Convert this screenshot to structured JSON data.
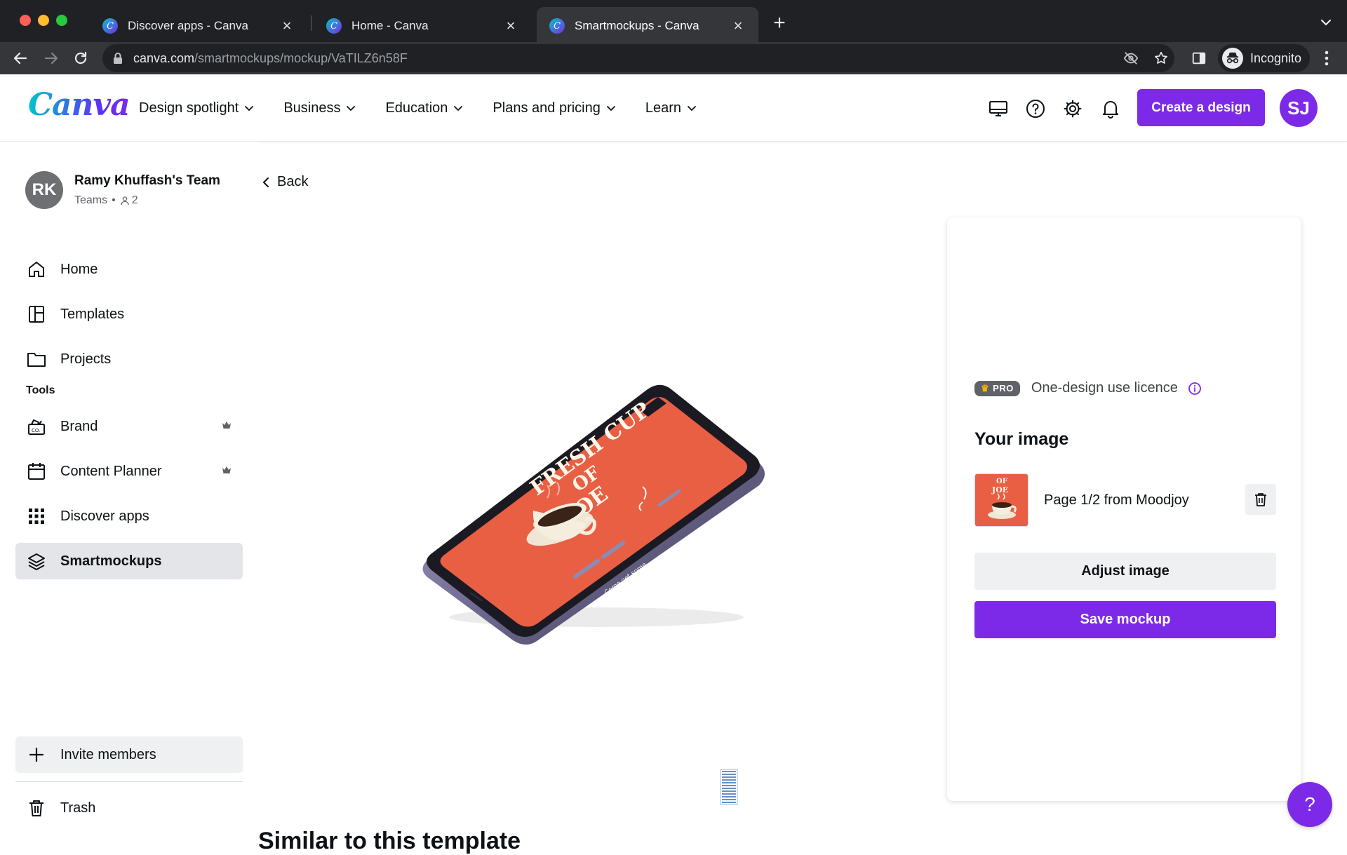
{
  "browser": {
    "tabs": [
      {
        "title": "Discover apps - Canva",
        "active": false
      },
      {
        "title": "Home - Canva",
        "active": false
      },
      {
        "title": "Smartmockups - Canva",
        "active": true
      }
    ],
    "favicon_glyph": "C",
    "close_glyph": "×",
    "new_tab_glyph": "+",
    "url_host": "canva.com",
    "url_path": "/smartmockups/mockup/VaTILZ6n58F",
    "incognito_label": "Incognito"
  },
  "header": {
    "logo": "Canva",
    "nav": [
      {
        "label": "Design spotlight"
      },
      {
        "label": "Business"
      },
      {
        "label": "Education"
      },
      {
        "label": "Plans and pricing"
      },
      {
        "label": "Learn"
      }
    ],
    "icons": [
      "desktop-icon",
      "help-icon",
      "settings-icon",
      "bell-icon"
    ],
    "create_button": "Create a design",
    "user_initials": "SJ"
  },
  "sidebar": {
    "team": {
      "initials": "RK",
      "name": "Ramy Khuffash's Team",
      "type": "Teams",
      "separator": "•",
      "members": "2"
    },
    "items": [
      {
        "label": "Home",
        "icon": "home-icon"
      },
      {
        "label": "Templates",
        "icon": "templates-icon"
      },
      {
        "label": "Projects",
        "icon": "folder-icon"
      }
    ],
    "tools_label": "Tools",
    "tools": [
      {
        "label": "Brand",
        "icon": "brand-icon",
        "pro": true
      },
      {
        "label": "Content Planner",
        "icon": "calendar-icon",
        "pro": true
      },
      {
        "label": "Discover apps",
        "icon": "grid-icon",
        "pro": false
      },
      {
        "label": "Smartmockups",
        "icon": "layers-icon",
        "pro": false,
        "active": true
      }
    ],
    "invite_label": "Invite members",
    "trash_label": "Trash"
  },
  "main": {
    "back_label": "Back",
    "mockup_screen_text": {
      "headline_1": "FRESH CUP",
      "headline_2": "OF",
      "headline_3": "JOE",
      "tagline": "Come get some"
    },
    "similar_heading": "Similar to this template"
  },
  "panel": {
    "pro_badge": "PRO",
    "licence": "One-design use licence",
    "your_image_heading": "Your image",
    "image_label": "Page 1/2 from Moodjoy",
    "thumb_text_1": "OF",
    "thumb_text_2": "JOE",
    "adjust_button": "Adjust image",
    "save_button": "Save mockup"
  },
  "help_fab": "?",
  "colors": {
    "accent": "#7d2ae8",
    "poster": "#e85f44",
    "chrome_dark": "#202124"
  }
}
